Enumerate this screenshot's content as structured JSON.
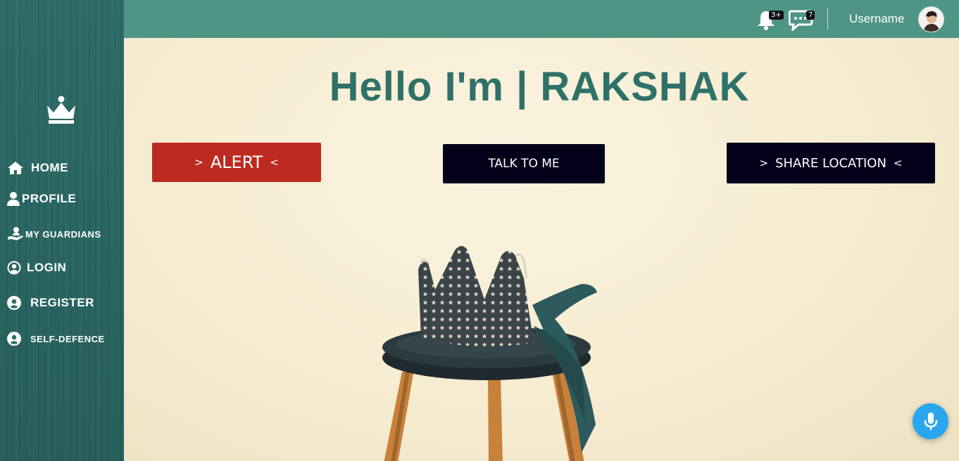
{
  "sidebar": {
    "logo_icon": "crown-icon",
    "items": [
      {
        "label": "HOME",
        "icon": "home-icon"
      },
      {
        "label": "PROFILE",
        "icon": "user-icon"
      },
      {
        "label": "MY GUARDIANS",
        "icon": "hand-user-icon"
      },
      {
        "label": "LOGIN",
        "icon": "user-circle-icon"
      },
      {
        "label": "REGISTER",
        "icon": "user-circle-icon"
      },
      {
        "label": "SELF-DEFENCE",
        "icon": "user-circle-icon"
      }
    ]
  },
  "topbar": {
    "notifications_count": "3+",
    "messages_count": "7",
    "username": "Username"
  },
  "main": {
    "title": "Hello I'm | RAKSHAK",
    "alert_label": "ALERT",
    "talk_label": "TALK TO ME",
    "share_label": "SHARE LOCATION",
    "chevron_left": ">",
    "chevron_right": "<"
  },
  "colors": {
    "sidebar": "#2f6c6a",
    "topbar": "#4f9585",
    "title": "#2f7168",
    "alert": "#bd2a20",
    "dark_button": "#03021a",
    "mic": "#2aa6ee"
  }
}
